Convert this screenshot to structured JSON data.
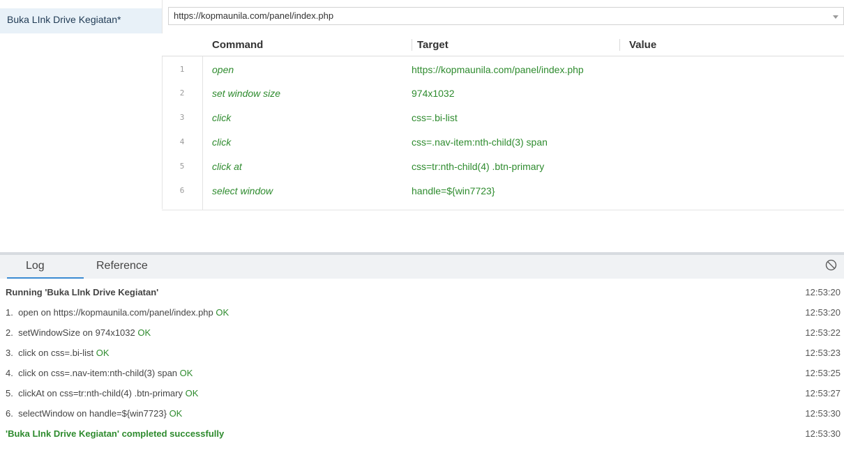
{
  "test_list": {
    "active_test": "Buka LInk Drive Kegiatan*"
  },
  "url_bar": {
    "value": "https://kopmaunila.com/panel/index.php",
    "dropdown_icon": "chevron-down-icon"
  },
  "command_table": {
    "headers": {
      "command": "Command",
      "target": "Target",
      "value": "Value"
    },
    "rows": [
      {
        "num": "1",
        "command": "open",
        "target": "https://kopmaunila.com/panel/index.php",
        "value": ""
      },
      {
        "num": "2",
        "command": "set window size",
        "target": "974x1032",
        "value": ""
      },
      {
        "num": "3",
        "command": "click",
        "target": "css=.bi-list",
        "value": ""
      },
      {
        "num": "4",
        "command": "click",
        "target": "css=.nav-item:nth-child(3) span",
        "value": ""
      },
      {
        "num": "5",
        "command": "click at",
        "target": "css=tr:nth-child(4) .btn-primary",
        "value": ""
      },
      {
        "num": "6",
        "command": "select window",
        "target": "handle=${win7723}",
        "value": ""
      }
    ]
  },
  "bottom_panel": {
    "tabs": [
      {
        "label": "Log",
        "active": true
      },
      {
        "label": "Reference",
        "active": false
      }
    ],
    "clear_icon": "clear-log-icon"
  },
  "log": {
    "running": {
      "text": "Running 'Buka LInk Drive Kegiatan'",
      "time": "12:53:20"
    },
    "entries": [
      {
        "prefix": "1.",
        "message": "open on https://kopmaunila.com/panel/index.php",
        "status": "OK",
        "time": "12:53:20"
      },
      {
        "prefix": "2.",
        "message": "setWindowSize on 974x1032",
        "status": "OK",
        "time": "12:53:22"
      },
      {
        "prefix": "3.",
        "message": "click on css=.bi-list",
        "status": "OK",
        "time": "12:53:23"
      },
      {
        "prefix": "4.",
        "message": "click on css=.nav-item:nth-child(3) span",
        "status": "OK",
        "time": "12:53:25"
      },
      {
        "prefix": "5.",
        "message": "clickAt on css=tr:nth-child(4) .btn-primary",
        "status": "OK",
        "time": "12:53:27"
      },
      {
        "prefix": "6.",
        "message": "selectWindow on handle=${win7723}",
        "status": "OK",
        "time": "12:53:30"
      }
    ],
    "completed": {
      "text": "'Buka LInk Drive Kegiatan' completed successfully",
      "time": "12:53:30"
    }
  },
  "colors": {
    "accent": "#3a8ad2",
    "ok_green": "#2e8b2e",
    "selected_test_bg": "#e8f1f8"
  }
}
